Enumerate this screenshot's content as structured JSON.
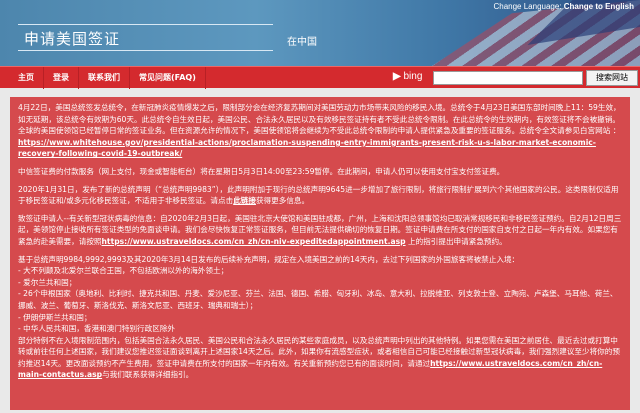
{
  "header": {
    "lang_label": "Change Language:",
    "lang_link": "Change to English",
    "title": "申请美国签证",
    "subtitle": "在中国"
  },
  "nav": {
    "items": [
      "主页",
      "登录",
      "联系我们",
      "常见问题(FAQ)"
    ],
    "bing": "bing",
    "search_button": "搜索网站",
    "search_value": ""
  },
  "notice": {
    "p1": "4月22日，美国总统签发总统令，在新冠肺炎疫情爆发之后，限制部分会在经济复苏期间对美国劳动力市场带来风险的移民入境。总统令于4月23日美国东部时间晚上11：59生效，如无延期，该总统令有效期为60天。此总统令自生效日起，美国公民、合法永久居民以及有效移民签证持有者不受此总统令限制。在此总统令的生效期内，有效签证将不会被撤销。全球的美国使领馆已经暂停日常的签证业务。但在资源允许的情况下，美国使领馆将会继续为不受此总统令限制的申请人提供紧急及重要的签证服务。总统令全文请参见白宫网站 ：",
    "p1_link": "https://www.whitehouse.gov/presidential-actions/proclamation-suspending-entry-immigrants-present-risk-u-s-labor-market-economic-recovery-following-covid-19-outbreak/",
    "p2": "中信签证费的付款服务（网上支付，现金或智能柜台）将在星期日5月3日14:00至23:59暂停。在此期间，申请人仍可以使用支付宝支付签证费。",
    "p3": "2020年1月31日，发布了新的总统声明（“总统声明9983”），此声明附加于现行的总统声明9645进一步增加了旅行限制，将旅行限制扩展到六个其他国家的公民。这类限制仅适用于移民签证和/或多元化移民签证，不适用于非移民签证。请点击",
    "p3_link": "此链接",
    "p3_end": "获得更多信息。",
    "p4": "致签证申请人--有关新型冠状病毒的信息：自2020年2月3日起，美国驻北京大使馆和美国驻成都，广州，上海和沈阳总领事馆均已取消常规移民和非移民签证预约。自2月12日周三起，美领馆停止接收所有签证类型的免面谈申请。我们会尽快恢复正常签证服务，但目前无法提供确切的恢复日期。签证申请费在所支付的国家自支付之日起一年内有效。如果您有紧急的赴美需要，请按照",
    "p4_link": "https://www.ustraveldocs.com/cn_zh/cn-niv-expeditedappointment.asp",
    "p4_end": " 上的指引提出申请紧急预约。",
    "p5_lines": [
      "基于总统声明9984,9992,9993及其2020年3月14日发布的后续补充声明，规定在入境美国之前的14天内，去过下列国家的外国旅客将被禁止入境：",
      "- 大不列颠及北爱尔兰联合王国，不包括欧洲以外的海外领土；",
      "- 爱尔兰共和国；",
      "- 26个申根国家（奥地利、比利时、捷克共和国、丹麦、爱沙尼亚、芬兰、法国、德国、希腊、匈牙利、冰岛、意大利、拉脱维亚、列支敦士登、立陶宛、卢森堡、马耳他、荷兰、挪威、波兰、葡萄牙、斯洛伐克、斯洛文尼亚、西班牙、瑞典和瑞士）；",
      "- 伊朗伊斯兰共和国；",
      "- 中华人民共和国，香港和澳门特别行政区除外"
    ],
    "p5_rest": "部分特例不在入境限制范围内，包括美国合法永久居民、美国公民和合法永久居民的某些家庭成员，以及总统声明中列出的其他特例。如果您需在美国之前居住、最近去过或打算中转或前往任何上述国家，我们建议您推迟签证面谈到离开上述国家14天之后。此外，如果你有流感型症状，或者相信自己可能已经接触过新型冠状病毒，我们强烈建议至少将你的预约推迟14天。更改面谈预约不产生费用，签证申请费在所支付的国家一年内有效。有关重新预约您已有的面谈时间，请通过",
    "p5_link": "https://www.ustraveldocs.com/cn_zh/cn-main-contactus.asp",
    "p5_end": "与我们联系获得详细指引。"
  }
}
